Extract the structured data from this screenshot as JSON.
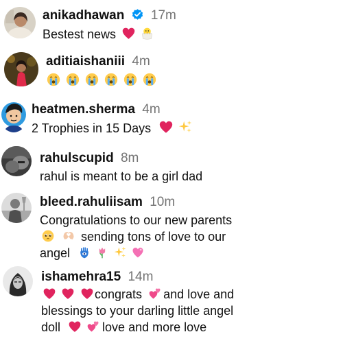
{
  "comments": [
    {
      "username": "anikadhawan",
      "verified": true,
      "time": "17m",
      "text": "Bestest news",
      "emojis": [
        "red-heart",
        "hatching-chick"
      ]
    },
    {
      "username": "aditiaishaniii",
      "time": "4m",
      "emojis": [
        "loudly-crying-face",
        "loudly-crying-face",
        "loudly-crying-face",
        "loudly-crying-face",
        "loudly-crying-face",
        "loudly-crying-face"
      ]
    },
    {
      "username": "heatmen.sherma",
      "time": "4m",
      "text": "2 Trophies in 15 Days",
      "emojis": [
        "red-heart",
        "sparkles"
      ]
    },
    {
      "username": "rahulscupid",
      "time": "8m",
      "text": "rahul is meant to be a girl dad"
    },
    {
      "username": "bleed.rahuliisam",
      "time": "10m",
      "line1": "Congratulations to our new parents",
      "line2": "sending tons of love to our",
      "line3": "angel",
      "emojis_line2": [
        "pleading-face",
        "heart-hands"
      ],
      "emojis_line3": [
        "hamsa",
        "tulip",
        "sparkles",
        "sparkling-heart"
      ]
    },
    {
      "username": "ishamehra15",
      "time": "14m",
      "line1_text": "congrats",
      "line1_text2": "and love and",
      "line2": "blessings to your darling little angel",
      "line3_start": "doll",
      "line3_end": "love and more love",
      "emojis_line1": [
        "red-heart",
        "red-heart",
        "red-heart"
      ],
      "emojis_line1b": [
        "two-hearts"
      ],
      "emojis_line3": [
        "red-heart",
        "two-hearts"
      ]
    }
  ],
  "colors": {
    "text": "#111111",
    "secondary": "#737373",
    "verified": "#0095f6",
    "heart": "#e0245e"
  }
}
